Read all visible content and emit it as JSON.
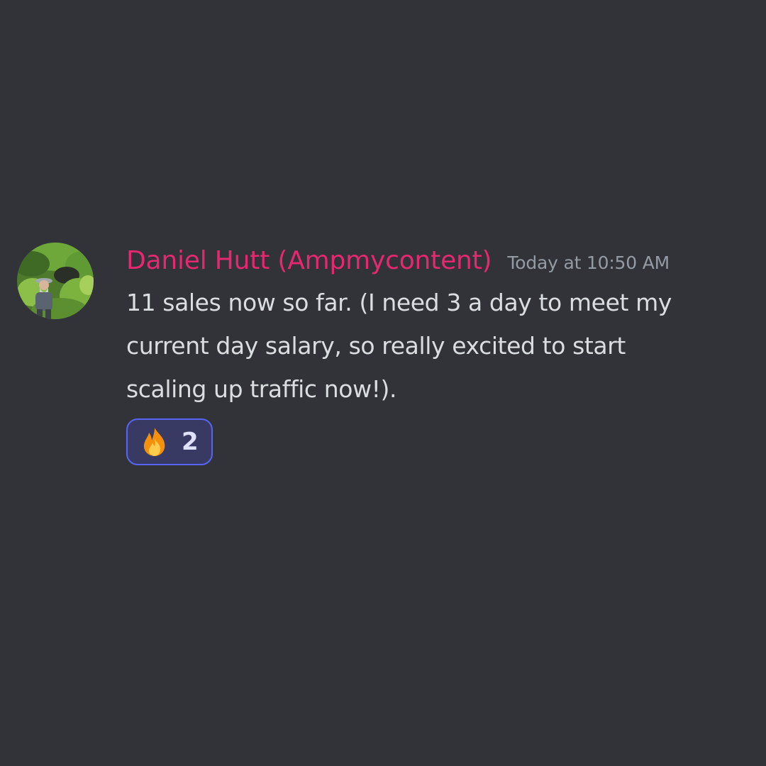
{
  "message": {
    "author": {
      "display_name": "Daniel Hutt (Ampmycontent)",
      "name_color": "#e52870",
      "avatar": "avatar-photo"
    },
    "timestamp": "Today at 10:50 AM",
    "lines": [
      "11 sales now so far. (I need 3 a day to meet my",
      "current day salary, so really excited to start",
      "scaling up traffic now!)."
    ],
    "reactions": [
      {
        "emoji": "fire-icon",
        "count": "2",
        "reacted_by_me": true
      }
    ]
  },
  "colors": {
    "background": "#313338",
    "text": "#dbdee1",
    "muted": "#949ba4",
    "reaction_border": "#5865f2",
    "reaction_bg": "#383a64"
  }
}
